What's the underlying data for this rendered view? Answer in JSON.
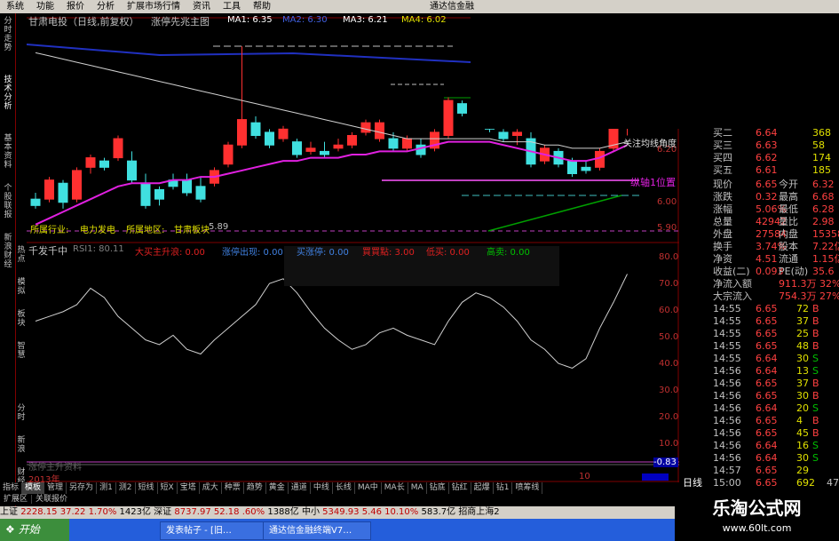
{
  "menu": [
    "系统",
    "功能",
    "报价",
    "分析",
    "扩展市场行情",
    "资讯",
    "工具",
    "帮助"
  ],
  "window_title": "通达信金融",
  "left_tabs": [
    "分时走势",
    "技术分析",
    "基本资料",
    "个股联报",
    "新浪财经"
  ],
  "left_side": [
    "热点",
    "模拟",
    "板块",
    "智慧",
    "分时",
    "新浪",
    "财经"
  ],
  "header": {
    "stock": "甘肃电投（日线,前复权）",
    "indicator": "涨停先兆主图",
    "ma1": "MA1: 6.35",
    "ma2": "MA2: 6.30",
    "ma3": "MA3: 6.21",
    "ma4": "MA4: 6.02"
  },
  "price_axis": [
    "6.20",
    "6.00",
    "5.90"
  ],
  "annotations": {
    "focus": "关注均线角度",
    "axis": "纵轴1位置",
    "industry": "所属行业:",
    "industry_val": "电力发电",
    "region": "所属地区:",
    "region_val": "甘肃板块",
    "low": "5.89"
  },
  "sub_header": {
    "name": "千发千中",
    "rsi": "RSI1: 80.11",
    "buy_main": "大买主升浪: 0.00",
    "limit_up": "涨停出现: 0.00",
    "buy_limit": "买涨停: 0.00",
    "buy_point": "買買點: 3.00",
    "sell": "低买: 0.00",
    "high_sell": "高卖: 0.00"
  },
  "sub_axis": [
    "80.00",
    "70.00",
    "60.00",
    "50.00",
    "40.00",
    "30.00",
    "20.00",
    "10.00"
  ],
  "sub_low": "-0.83",
  "sub_bottom_label": "涨停主升资料",
  "year_label": "2013年",
  "bottom_num": "10",
  "quotes": [
    {
      "label": "买二",
      "price": "6.64",
      "vol": "368"
    },
    {
      "label": "买三",
      "price": "6.63",
      "vol": "58"
    },
    {
      "label": "买四",
      "price": "6.62",
      "vol": "174"
    },
    {
      "label": "买五",
      "price": "6.61",
      "vol": "185"
    }
  ],
  "stats": [
    {
      "l1": "现价",
      "v1": "6.65",
      "l2": "今开",
      "v2": "6.32"
    },
    {
      "l1": "涨跌",
      "v1": "0.32",
      "l2": "最高",
      "v2": "6.68"
    },
    {
      "l1": "涨幅",
      "v1": "5.06%",
      "l2": "最低",
      "v2": "6.28"
    },
    {
      "l1": "总量",
      "v1": "42942",
      "l2": "量比",
      "v2": "2.98"
    },
    {
      "l1": "外盘",
      "v1": "27584",
      "l2": "内盘",
      "v2": "15358"
    },
    {
      "l1": "换手",
      "v1": "3.74%",
      "l2": "股本",
      "v2": "7.22亿"
    },
    {
      "l1": "净资",
      "v1": "4.51",
      "l2": "流通",
      "v2": "1.15亿"
    },
    {
      "l1": "收益(二)",
      "v1": "0.093",
      "l2": "PE(动)",
      "v2": "35.6"
    }
  ],
  "flow": [
    {
      "label": "净流入额",
      "val": "911.3万",
      "pct": "32%"
    },
    {
      "label": "大宗流入",
      "val": "754.3万",
      "pct": "27%"
    }
  ],
  "ticks": [
    {
      "t": "14:55",
      "p": "6.65",
      "v": "72",
      "d": "B"
    },
    {
      "t": "14:55",
      "p": "6.65",
      "v": "37",
      "d": "B"
    },
    {
      "t": "14:55",
      "p": "6.65",
      "v": "25",
      "d": "B"
    },
    {
      "t": "14:55",
      "p": "6.65",
      "v": "48",
      "d": "B"
    },
    {
      "t": "14:55",
      "p": "6.64",
      "v": "30",
      "d": "S"
    },
    {
      "t": "14:56",
      "p": "6.64",
      "v": "13",
      "d": "S"
    },
    {
      "t": "14:56",
      "p": "6.65",
      "v": "37",
      "d": "B"
    },
    {
      "t": "14:56",
      "p": "6.65",
      "v": "30",
      "d": "B"
    },
    {
      "t": "14:56",
      "p": "6.64",
      "v": "20",
      "d": "S"
    },
    {
      "t": "14:56",
      "p": "6.65",
      "v": "4",
      "d": "B"
    },
    {
      "t": "14:56",
      "p": "6.65",
      "v": "45",
      "d": "B"
    },
    {
      "t": "14:56",
      "p": "6.64",
      "v": "16",
      "d": "S"
    },
    {
      "t": "14:56",
      "p": "6.64",
      "v": "30",
      "d": "S"
    },
    {
      "t": "14:57",
      "p": "6.65",
      "v": "29",
      "d": ""
    },
    {
      "t": "15:00",
      "p": "6.65",
      "v": "692",
      "d": ""
    }
  ],
  "daily_label": "日线",
  "last_col": "47",
  "tabs": [
    "指标",
    "模板",
    "管理",
    "另存为",
    "测1",
    "测2",
    "短线",
    "短X",
    "宝塔",
    "成大",
    "种票",
    "趋势",
    "黄金",
    "通道",
    "中线",
    "长线",
    "MA中",
    "MA长",
    "MA",
    "钻底",
    "钻红",
    "起爆",
    "钻1",
    "喷筹线"
  ],
  "subbar": [
    "扩展区",
    "关联报价"
  ],
  "status": {
    "sh_label": "上证",
    "sh": "2228.15",
    "sh_chg": "37.22",
    "sh_pct": "1.70%",
    "sh_amt": "1423亿",
    "sz_label": "深证",
    "sz": "8737.97",
    "sz_chg": "52.18",
    "sz_pct": ".60%",
    "sz_amt": "1388亿",
    "mid_label": "中小",
    "mid": "5349.93",
    "mid_chg": "5.46",
    "mid_pct": "10.10%",
    "mid_amt": "583.7亿",
    "extra": "招商上海2"
  },
  "taskbar": {
    "start": "开始",
    "tasks": [
      "发表帖子 - [旧…",
      "通达信金融终端V7…"
    ]
  },
  "brand": {
    "name": "乐淘公式网",
    "url": "www.60lt.com"
  },
  "chart_data": {
    "type": "candlestick",
    "title": "甘肃电投（日线,前复权）",
    "candles": [
      [
        6.0,
        6.02,
        5.97,
        5.98
      ],
      [
        6.0,
        6.07,
        5.99,
        6.06
      ],
      [
        6.05,
        6.06,
        5.97,
        5.99
      ],
      [
        6.0,
        6.1,
        5.99,
        6.09
      ],
      [
        6.1,
        6.14,
        6.08,
        6.13
      ],
      [
        6.12,
        6.13,
        6.09,
        6.1
      ],
      [
        6.13,
        6.2,
        6.12,
        6.19
      ],
      [
        6.12,
        6.15,
        6.05,
        6.06
      ],
      [
        6.05,
        6.08,
        5.97,
        5.98
      ],
      [
        6.03,
        6.04,
        5.98,
        6.0
      ],
      [
        6.06,
        6.08,
        6.03,
        6.04
      ],
      [
        6.06,
        6.08,
        6.01,
        6.02
      ],
      [
        6.04,
        6.07,
        5.99,
        6.0
      ],
      [
        6.05,
        6.1,
        6.04,
        6.09
      ],
      [
        6.11,
        6.18,
        6.1,
        6.17
      ],
      [
        6.17,
        6.48,
        6.16,
        6.25
      ],
      [
        6.24,
        6.26,
        6.19,
        6.2
      ],
      [
        6.21,
        6.22,
        6.16,
        6.17
      ],
      [
        6.19,
        6.23,
        6.18,
        6.22
      ],
      [
        6.18,
        6.19,
        6.13,
        6.14
      ],
      [
        6.15,
        6.18,
        6.14,
        6.16
      ],
      [
        6.15,
        6.18,
        6.13,
        6.14
      ],
      [
        6.16,
        6.19,
        6.15,
        6.17
      ],
      [
        6.17,
        6.21,
        6.16,
        6.2
      ],
      [
        6.21,
        6.25,
        6.2,
        6.24
      ],
      [
        6.19,
        6.25,
        6.18,
        6.24
      ],
      [
        6.19,
        6.21,
        6.15,
        6.16
      ],
      [
        6.16,
        6.2,
        6.15,
        6.19
      ],
      [
        6.17,
        6.19,
        6.13,
        6.14
      ],
      [
        6.16,
        6.22,
        6.15,
        6.21
      ],
      [
        6.2,
        6.32,
        6.19,
        6.31
      ],
      [
        6.3,
        6.31,
        6.26,
        6.27
      ],
      [
        6.29,
        6.3,
        6.24,
        6.25
      ],
      [
        6.24,
        6.26,
        6.21,
        6.22
      ],
      [
        6.21,
        6.22,
        6.18,
        6.19
      ],
      [
        6.2,
        6.22,
        6.17,
        6.21
      ],
      [
        6.19,
        6.21,
        6.1,
        6.11
      ],
      [
        6.12,
        6.17,
        6.11,
        6.16
      ],
      [
        6.15,
        6.16,
        6.1,
        6.11
      ],
      [
        6.12,
        6.13,
        6.07,
        6.08
      ],
      [
        6.1,
        6.12,
        6.08,
        6.09
      ],
      [
        6.1,
        6.16,
        6.09,
        6.15
      ],
      [
        6.16,
        6.25,
        6.15,
        6.24
      ],
      [
        6.23,
        6.28,
        6.2,
        6.26
      ]
    ],
    "ma_white": [
      6.46,
      6.45,
      6.44,
      6.43,
      6.42,
      6.41,
      6.4,
      6.39,
      6.38,
      6.37,
      6.36,
      6.35,
      6.34,
      6.33,
      6.32,
      6.31,
      6.3,
      6.29,
      6.28,
      6.27,
      6.26,
      6.25,
      6.24,
      6.23,
      6.22,
      6.21,
      6.2,
      6.19,
      6.19,
      6.19,
      6.19,
      6.19,
      6.19,
      6.19,
      6.18,
      6.18,
      6.18,
      6.17,
      6.17,
      6.16,
      6.16,
      6.16,
      6.17,
      6.18
    ],
    "ma_magenta": [
      5.92,
      5.94,
      5.96,
      5.98,
      6.0,
      6.02,
      6.04,
      6.05,
      6.05,
      6.05,
      6.06,
      6.06,
      6.07,
      6.07,
      6.08,
      6.09,
      6.1,
      6.11,
      6.12,
      6.12,
      6.13,
      6.13,
      6.13,
      6.14,
      6.14,
      6.15,
      6.15,
      6.15,
      6.16,
      6.17,
      6.18,
      6.18,
      6.18,
      6.18,
      6.17,
      6.16,
      6.15,
      6.14,
      6.13,
      6.12,
      6.12,
      6.13,
      6.15,
      6.17
    ],
    "rsi": [
      58,
      60,
      62,
      65,
      72,
      68,
      60,
      55,
      50,
      48,
      52,
      46,
      44,
      50,
      55,
      60,
      65,
      74,
      76,
      70,
      62,
      55,
      50,
      46,
      48,
      53,
      55,
      52,
      50,
      48,
      58,
      66,
      70,
      68,
      64,
      58,
      50,
      46,
      40,
      38,
      42,
      55,
      66,
      78
    ]
  }
}
